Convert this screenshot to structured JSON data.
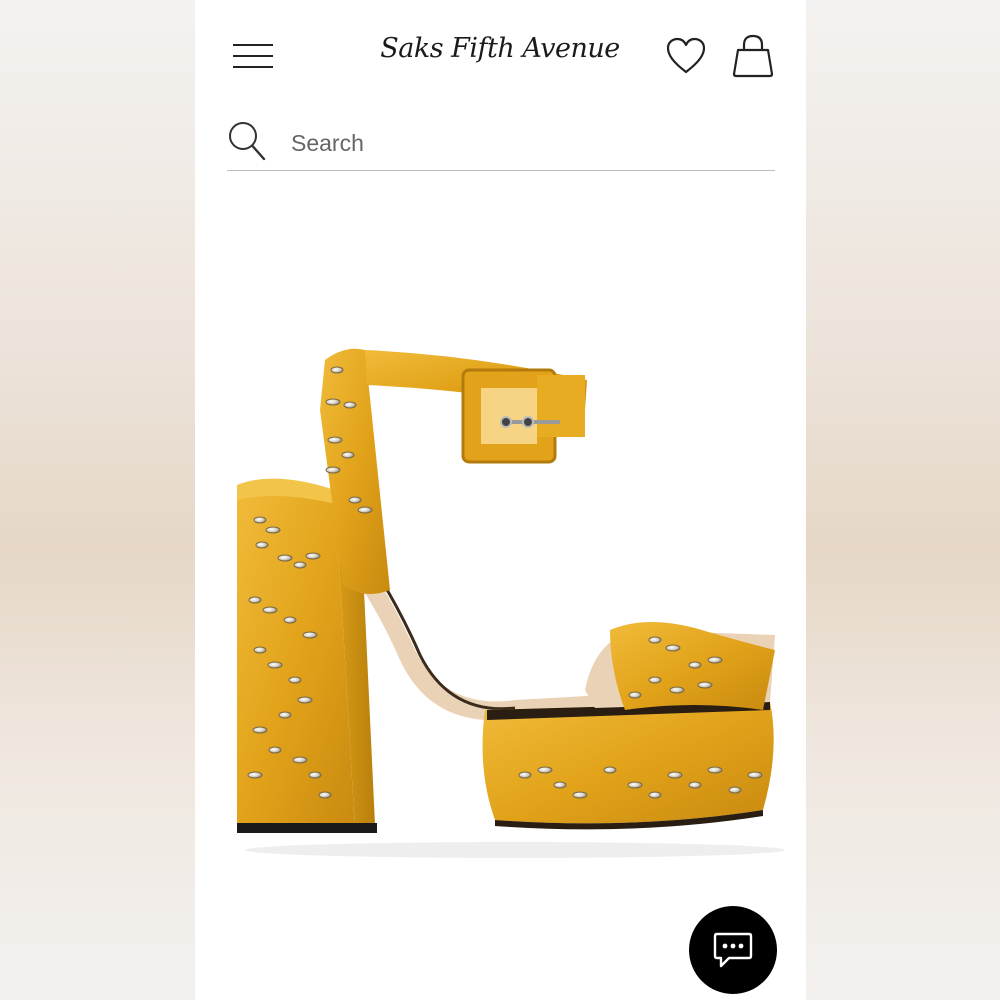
{
  "header": {
    "brand": "Saks Fifth Avenue",
    "menu_icon": "hamburger-menu-icon",
    "wishlist_icon": "heart-icon",
    "bag_icon": "shopping-bag-icon"
  },
  "search": {
    "placeholder": "Search",
    "icon": "search-icon"
  },
  "product": {
    "image": "yellow satin crystal-embellished platform sandal",
    "color": "#e3a51c"
  },
  "chat": {
    "icon": "chat-bubble-icon"
  },
  "colors": {
    "background": "#ffffff",
    "text": "#1b1b1b",
    "divider": "#bdbdbd",
    "chat_button": "#000000",
    "side_blur": "#e6d7c7"
  }
}
